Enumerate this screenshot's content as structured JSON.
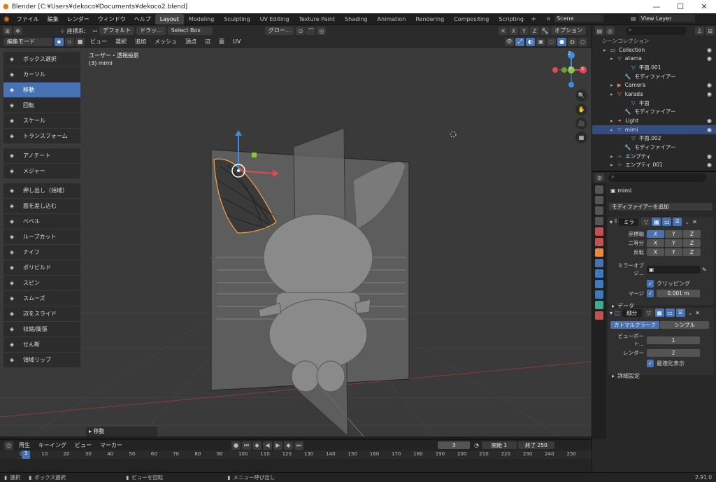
{
  "window": {
    "title": "Blender [C:¥Users¥dekoco¥Documents¥dekoco2.blend]"
  },
  "menu": [
    "ファイル",
    "編集",
    "レンダー",
    "ウィンドウ",
    "ヘルプ"
  ],
  "workspaces": [
    "Layout",
    "Modeling",
    "Sculpting",
    "UV Editing",
    "Texture Paint",
    "Shading",
    "Animation",
    "Rendering",
    "Compositing",
    "Scripting"
  ],
  "scene": "Scene",
  "view_layer": "View Layer",
  "header": {
    "coord_label": "座標系:",
    "coord_value": "デフォルト",
    "drag_label": "ドラッ...",
    "select_box": "Select Box",
    "global": "グロー...",
    "options": "オプション",
    "x": "X",
    "y": "Y",
    "z": "Z"
  },
  "header2": {
    "mode": "編集モード",
    "view": "ビュー",
    "select": "選択",
    "add": "追加",
    "mesh": "メッシュ",
    "vertex": "頂点",
    "edge": "辺",
    "face": "面",
    "uv": "UV"
  },
  "viewport": {
    "perspective": "ユーザー・透視投影",
    "object": "(3) mimi",
    "last_op": "移動"
  },
  "gizmo": {
    "x": "X",
    "y": "Y",
    "z": "Z"
  },
  "tools": [
    {
      "label": "ボックス選択",
      "icon": "box-select-icon"
    },
    {
      "label": "カーソル",
      "icon": "cursor-icon"
    },
    {
      "label": "移動",
      "icon": "move-icon",
      "active": true
    },
    {
      "label": "回転",
      "icon": "rotate-icon"
    },
    {
      "label": "スケール",
      "icon": "scale-icon"
    },
    {
      "label": "トランスフォーム",
      "icon": "transform-icon"
    },
    {
      "label": "アノテート",
      "icon": "annotate-icon",
      "gap": true
    },
    {
      "label": "メジャー",
      "icon": "measure-icon"
    },
    {
      "label": "押し出し（領域）",
      "icon": "extrude-icon",
      "gap": true
    },
    {
      "label": "面を差し込む",
      "icon": "inset-icon"
    },
    {
      "label": "ベベル",
      "icon": "bevel-icon"
    },
    {
      "label": "ループカット",
      "icon": "loopcut-icon"
    },
    {
      "label": "ナイフ",
      "icon": "knife-icon"
    },
    {
      "label": "ポリビルド",
      "icon": "polybuild-icon"
    },
    {
      "label": "スピン",
      "icon": "spin-icon"
    },
    {
      "label": "スムーズ",
      "icon": "smooth-icon"
    },
    {
      "label": "辺をスライド",
      "icon": "edge-slide-icon"
    },
    {
      "label": "収縮/膨張",
      "icon": "shrink-fatten-icon"
    },
    {
      "label": "せん断",
      "icon": "shear-icon"
    },
    {
      "label": "領域リップ",
      "icon": "rip-region-icon"
    }
  ],
  "outliner": {
    "header": "シーンコレクション",
    "rows": [
      {
        "label": "Collection",
        "indent": 1,
        "icon": "collection-icon",
        "color": "#ddd"
      },
      {
        "label": "atama",
        "indent": 2,
        "icon": "mesh-object-icon",
        "color": "#e88a3a"
      },
      {
        "label": "平面.001",
        "indent": 4,
        "icon": "mesh-data-icon",
        "color": "#5ccfaa"
      },
      {
        "label": "モディファイアー",
        "indent": 3,
        "icon": "modifier-icon",
        "color": "#7a9fd6"
      },
      {
        "label": "Camera",
        "indent": 2,
        "icon": "camera-icon",
        "color": "#e88a3a"
      },
      {
        "label": "karada",
        "indent": 2,
        "icon": "mesh-object-icon",
        "color": "#e88a3a"
      },
      {
        "label": "平面",
        "indent": 4,
        "icon": "mesh-data-icon",
        "color": "#5ccfaa"
      },
      {
        "label": "モディファイアー",
        "indent": 3,
        "icon": "modifier-icon",
        "color": "#7a9fd6"
      },
      {
        "label": "Light",
        "indent": 2,
        "icon": "light-icon",
        "color": "#e88a3a"
      },
      {
        "label": "mimi",
        "indent": 2,
        "icon": "mesh-object-icon",
        "color": "#e88a3a",
        "sel": true
      },
      {
        "label": "平面.002",
        "indent": 4,
        "icon": "mesh-data-icon",
        "color": "#5ccfaa"
      },
      {
        "label": "モディファイアー",
        "indent": 3,
        "icon": "modifier-icon",
        "color": "#7a9fd6"
      },
      {
        "label": "エンプティ",
        "indent": 2,
        "icon": "empty-icon",
        "color": "#e88a3a"
      },
      {
        "label": "エンプティ.001",
        "indent": 2,
        "icon": "empty-icon",
        "color": "#e88a3a"
      }
    ]
  },
  "props": {
    "object": "mimi",
    "add_modifier": "モディファイアーを追加",
    "mirror": {
      "name": "ミラ",
      "axis_label": "座標軸",
      "bisect_label": "二等分",
      "flip_label": "反転",
      "mirror_obj": "ミラーオブジ...",
      "clipping": "クリッピング",
      "merge_label": "マージ",
      "merge_value": "0.001 m",
      "data": "データ"
    },
    "subsurf": {
      "name": "細分",
      "catmull": "カトマルクラーク",
      "simple": "シンプル",
      "viewport_label": "ビューポート...",
      "viewport_value": "1",
      "render_label": "レンダー",
      "render_value": "2",
      "optimal": "最適化表示",
      "advanced": "詳細設定"
    }
  },
  "timeline": {
    "playback": "再生",
    "keying": "キーイング",
    "view": "ビュー",
    "marker": "マーカー",
    "current": "3",
    "start_label": "開始",
    "start": "1",
    "end_label": "終了",
    "end": "250",
    "ticks": [
      "0",
      "10",
      "20",
      "30",
      "40",
      "50",
      "60",
      "70",
      "80",
      "90",
      "100",
      "110",
      "120",
      "130",
      "140",
      "150",
      "160",
      "170",
      "180",
      "190",
      "200",
      "210",
      "220",
      "230",
      "240",
      "250"
    ]
  },
  "status": {
    "select": "選択",
    "box_select": "ボックス選択",
    "rotate_view": "ビューを回転",
    "call_menu": "メニュー呼び出し",
    "version": "2.91.0"
  },
  "colors": {
    "accent": "#4772b3",
    "x_axis": "#e04a52",
    "y_axis": "#8bc34a",
    "z_axis": "#3f8ce0"
  }
}
